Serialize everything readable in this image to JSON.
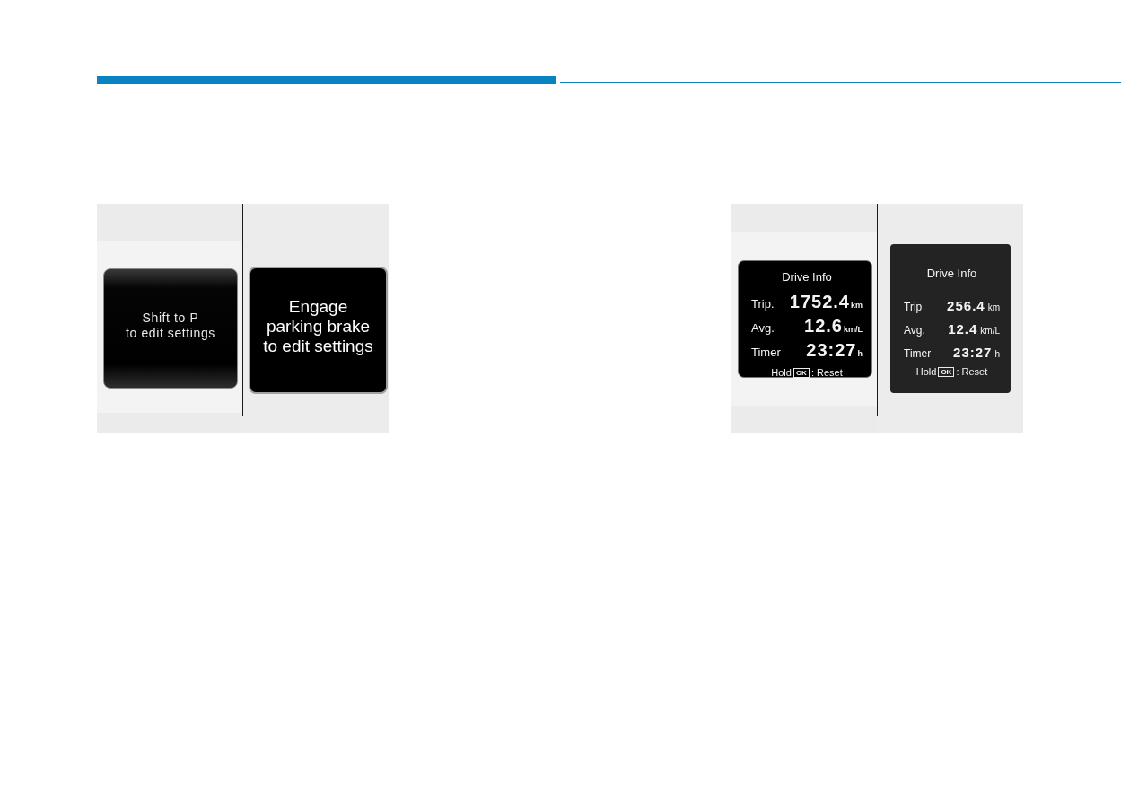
{
  "figures": [
    {
      "screens": [
        {
          "kind": "message",
          "lines": [
            "Shift to P",
            "to edit settings"
          ]
        },
        {
          "kind": "message",
          "lines": [
            "Engage",
            "parking brake",
            "to edit settings"
          ]
        }
      ]
    },
    {
      "screens": [
        {
          "kind": "drive-info",
          "title": "Drive Info",
          "rows": [
            {
              "label": "Trip.",
              "value": "1752.4",
              "unit": "km"
            },
            {
              "label": "Avg.",
              "value": "12.6",
              "unit": "km/L"
            },
            {
              "label": "Timer",
              "value": "23:27",
              "unit": "h"
            }
          ],
          "hint": {
            "before": "Hold",
            "key": "OK",
            "after": ": Reset"
          }
        },
        {
          "kind": "drive-info",
          "title": "Drive Info",
          "rows": [
            {
              "label": "Trip",
              "value": "256.4",
              "unit": "km"
            },
            {
              "label": "Avg.",
              "value": "12.4",
              "unit": "km/L"
            },
            {
              "label": "Timer",
              "value": "23:27",
              "unit": "h"
            }
          ],
          "hint": {
            "before": "Hold",
            "key": "OK",
            "after": ": Reset"
          }
        }
      ]
    }
  ]
}
